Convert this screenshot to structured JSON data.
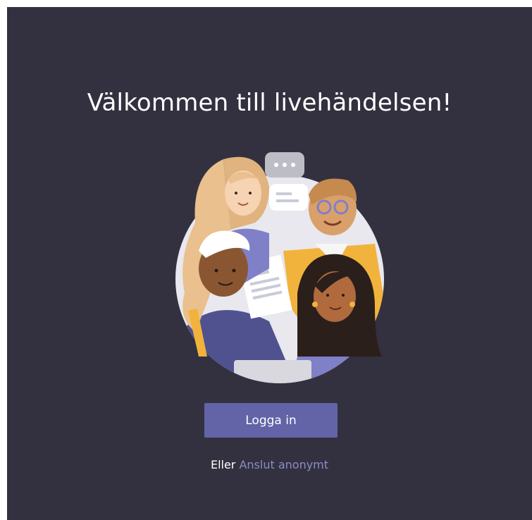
{
  "welcome": {
    "title": "Välkommen till livehändelsen!",
    "illustration_name": "people-group-illustration"
  },
  "login": {
    "label": "Logga in"
  },
  "alternative": {
    "prefix": "Eller",
    "link_label": "Anslut anonymt"
  },
  "colors": {
    "background": "#33313f",
    "accent": "#6264a7",
    "link": "#8b8cc7",
    "text": "#ffffff"
  }
}
